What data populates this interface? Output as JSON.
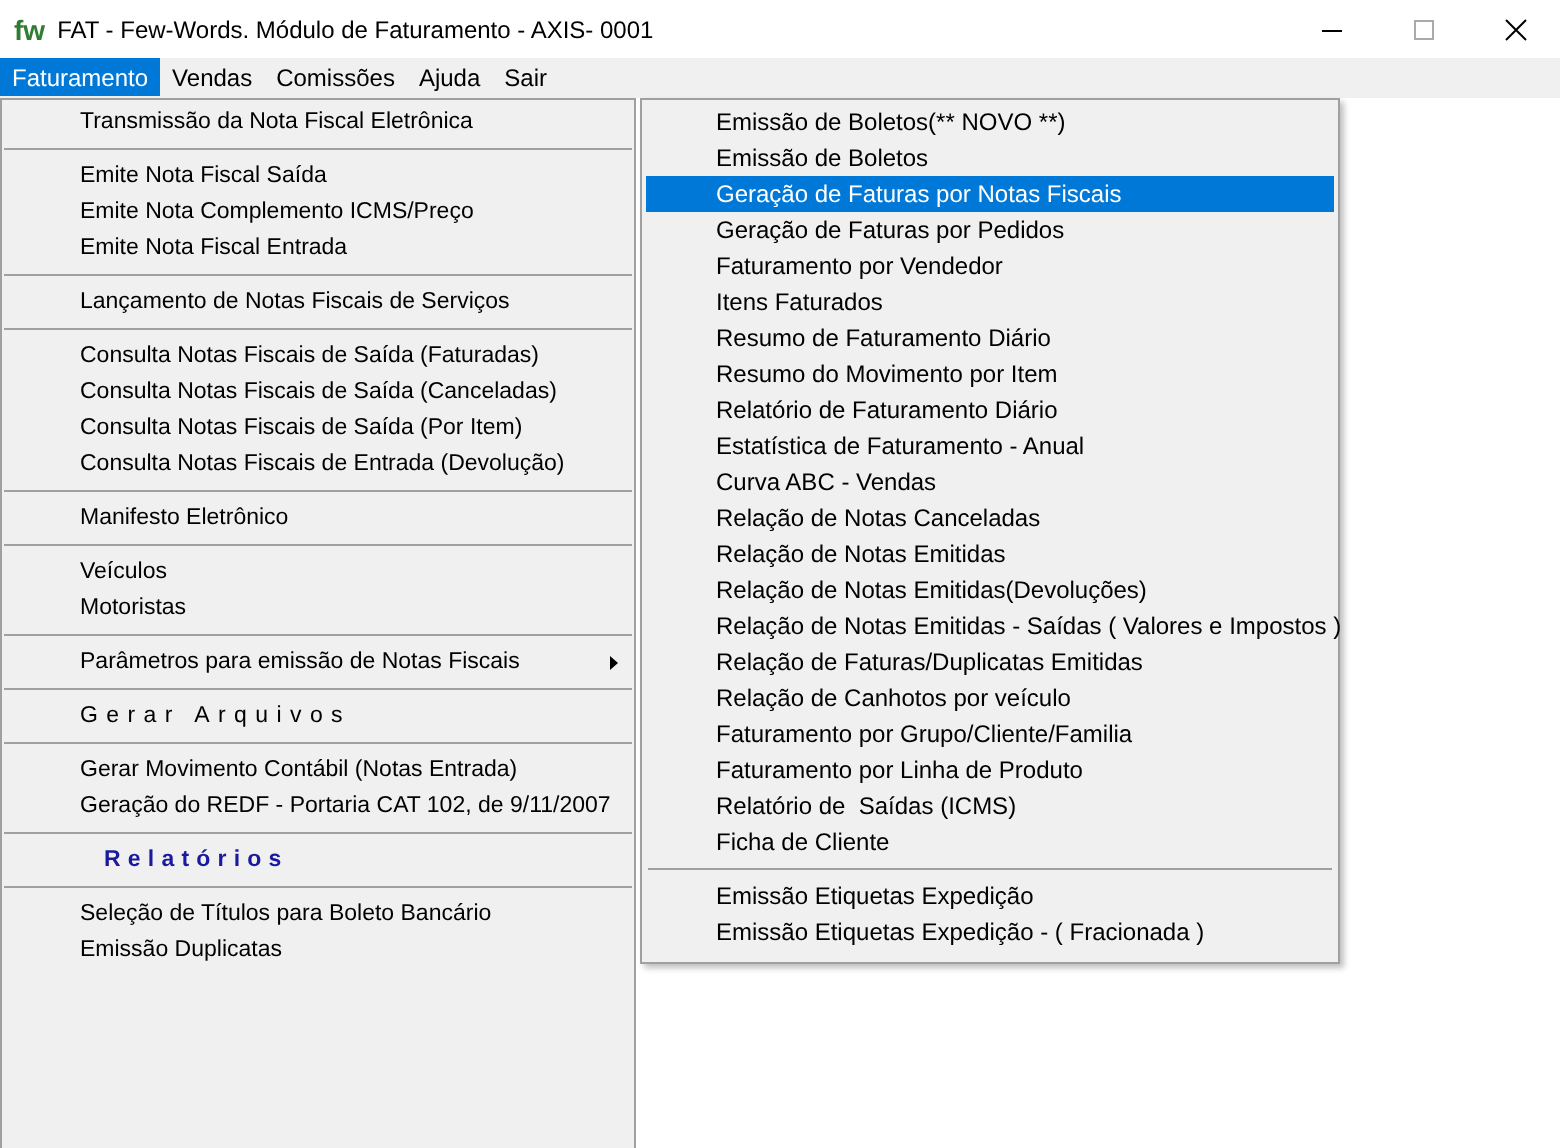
{
  "window": {
    "logo": "fw",
    "title": "FAT - Few-Words. Módulo de Faturamento - AXIS- 0001"
  },
  "menubar": [
    {
      "label": "Faturamento",
      "selected": true
    },
    {
      "label": "Vendas",
      "selected": false
    },
    {
      "label": "Comissões",
      "selected": false
    },
    {
      "label": "Ajuda",
      "selected": false
    },
    {
      "label": "Sair",
      "selected": false
    }
  ],
  "menu": [
    {
      "kind": "item",
      "label": "Transmissão da Nota Fiscal Eletrônica",
      "submenu": false
    },
    {
      "kind": "separator"
    },
    {
      "kind": "item",
      "label": "Emite Nota Fiscal Saída",
      "submenu": false
    },
    {
      "kind": "item",
      "label": "Emite Nota Complemento ICMS/Preço",
      "submenu": false
    },
    {
      "kind": "item",
      "label": "Emite Nota Fiscal Entrada",
      "submenu": false
    },
    {
      "kind": "separator"
    },
    {
      "kind": "item",
      "label": "Lançamento de Notas Fiscais de Serviços",
      "submenu": false
    },
    {
      "kind": "separator"
    },
    {
      "kind": "item",
      "label": "Consulta Notas Fiscais de Saída (Faturadas)",
      "submenu": false
    },
    {
      "kind": "item",
      "label": "Consulta Notas Fiscais de Saída (Canceladas)",
      "submenu": false
    },
    {
      "kind": "item",
      "label": "Consulta Notas Fiscais de Saída (Por Item)",
      "submenu": false
    },
    {
      "kind": "item",
      "label": "Consulta Notas Fiscais de Entrada (Devolução)",
      "submenu": false
    },
    {
      "kind": "separator"
    },
    {
      "kind": "item",
      "label": "Manifesto Eletrônico",
      "submenu": false
    },
    {
      "kind": "separator"
    },
    {
      "kind": "item",
      "label": "Veículos",
      "submenu": false
    },
    {
      "kind": "item",
      "label": "Motoristas",
      "submenu": false
    },
    {
      "kind": "separator"
    },
    {
      "kind": "item",
      "label": "Parâmetros para emissão de Notas Fiscais",
      "submenu": true
    },
    {
      "kind": "separator"
    },
    {
      "kind": "spaced",
      "label": "Gerar Arquivos"
    },
    {
      "kind": "separator"
    },
    {
      "kind": "item",
      "label": "Gerar Movimento Contábil (Notas Entrada)",
      "submenu": false
    },
    {
      "kind": "item",
      "label": "Geração do REDF - Portaria CAT 102, de 9/11/2007",
      "submenu": false
    },
    {
      "kind": "separator"
    },
    {
      "kind": "heading",
      "label": "Relatórios"
    },
    {
      "kind": "separator"
    },
    {
      "kind": "item",
      "label": "Seleção de Títulos para Boleto Bancário",
      "submenu": false
    },
    {
      "kind": "item",
      "label": "Emissão Duplicatas",
      "submenu": false
    }
  ],
  "submenu": [
    {
      "kind": "item",
      "label": "Emissão de Boletos(** NOVO **)",
      "selected": false
    },
    {
      "kind": "item",
      "label": "Emissão de Boletos",
      "selected": false
    },
    {
      "kind": "item",
      "label": "Geração de Faturas por Notas Fiscais",
      "selected": true
    },
    {
      "kind": "item",
      "label": "Geração de Faturas por Pedidos",
      "selected": false
    },
    {
      "kind": "item",
      "label": "Faturamento por Vendedor",
      "selected": false
    },
    {
      "kind": "item",
      "label": "Itens Faturados",
      "selected": false
    },
    {
      "kind": "item",
      "label": "Resumo de Faturamento Diário",
      "selected": false
    },
    {
      "kind": "item",
      "label": "Resumo do Movimento por Item",
      "selected": false
    },
    {
      "kind": "item",
      "label": "Relatório de Faturamento Diário",
      "selected": false
    },
    {
      "kind": "item",
      "label": "Estatística de Faturamento - Anual",
      "selected": false
    },
    {
      "kind": "item",
      "label": "Curva ABC - Vendas",
      "selected": false
    },
    {
      "kind": "item",
      "label": "Relação de Notas Canceladas",
      "selected": false
    },
    {
      "kind": "item",
      "label": "Relação de Notas Emitidas",
      "selected": false
    },
    {
      "kind": "item",
      "label": "Relação de Notas Emitidas(Devoluções)",
      "selected": false
    },
    {
      "kind": "item",
      "label": "Relação de Notas Emitidas - Saídas ( Valores e Impostos )",
      "selected": false
    },
    {
      "kind": "item",
      "label": "Relação de Faturas/Duplicatas Emitidas",
      "selected": false
    },
    {
      "kind": "item",
      "label": "Relação de Canhotos por veículo",
      "selected": false
    },
    {
      "kind": "item",
      "label": "Faturamento por Grupo/Cliente/Familia",
      "selected": false
    },
    {
      "kind": "item",
      "label": "Faturamento por Linha de Produto",
      "selected": false
    },
    {
      "kind": "item",
      "label": "Relatório de  Saídas (ICMS)",
      "selected": false
    },
    {
      "kind": "item",
      "label": "Ficha de Cliente",
      "selected": false
    },
    {
      "kind": "separator"
    },
    {
      "kind": "item",
      "label": "Emissão Etiquetas Expedição",
      "selected": false
    },
    {
      "kind": "item",
      "label": "Emissão Etiquetas Expedição - ( Fracionada )",
      "selected": false
    }
  ]
}
